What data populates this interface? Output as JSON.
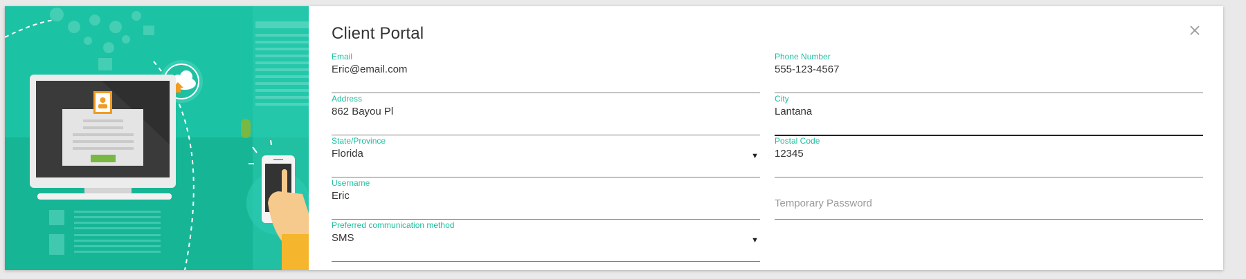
{
  "dialog": {
    "title": "Client Portal"
  },
  "fields": {
    "email": {
      "label": "Email",
      "value": "Eric@email.com"
    },
    "phone": {
      "label": "Phone Number",
      "value": "555-123-4567"
    },
    "address": {
      "label": "Address",
      "value": "862 Bayou Pl"
    },
    "city": {
      "label": "City",
      "value": "Lantana"
    },
    "state": {
      "label": "State/Province",
      "value": "Florida"
    },
    "postal": {
      "label": "Postal Code",
      "value": "12345"
    },
    "username": {
      "label": "Username",
      "value": "Eric"
    },
    "temp_password": {
      "placeholder": "Temporary Password"
    },
    "comm_method": {
      "label": "Preferred communication method",
      "value": "SMS"
    }
  },
  "icons": {
    "close": "close-icon",
    "dropdown": "chevron-down-icon",
    "dropdown_glyph": "▼"
  },
  "colors": {
    "accent": "#1cbf9f",
    "illustration_bg": "#1cc2a4",
    "text": "#333333"
  }
}
